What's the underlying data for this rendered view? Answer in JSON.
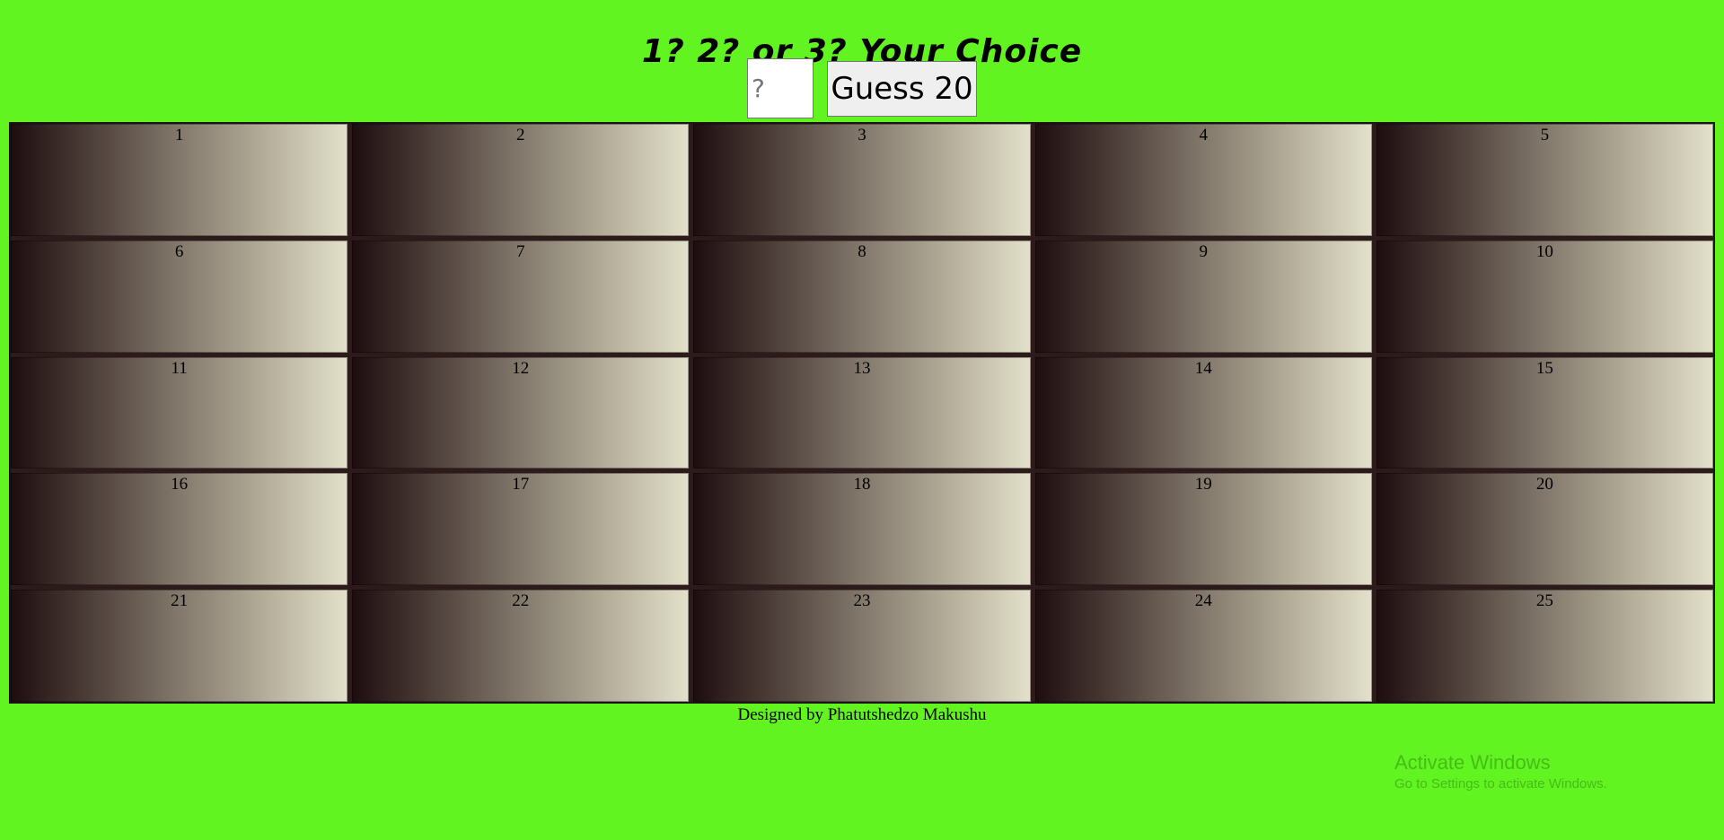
{
  "header": {
    "title": "1? 2? or 3? Your Choice"
  },
  "controls": {
    "input_placeholder": "?",
    "input_value": "",
    "button_label": "Guess 20"
  },
  "grid": {
    "cells": [
      "1",
      "2",
      "3",
      "4",
      "5",
      "6",
      "7",
      "8",
      "9",
      "10",
      "11",
      "12",
      "13",
      "14",
      "15",
      "16",
      "17",
      "18",
      "19",
      "20",
      "21",
      "22",
      "23",
      "24",
      "25"
    ]
  },
  "footer": {
    "credit": "Designed by Phatutshedzo Makushu"
  },
  "watermark": {
    "title": "Activate Windows",
    "subtitle": "Go to Settings to activate Windows."
  },
  "colors": {
    "background": "#62f420",
    "grid_border": "#2d1a1a",
    "gradient_start": "#1e0d0f",
    "gradient_end": "#e3e1cb"
  }
}
